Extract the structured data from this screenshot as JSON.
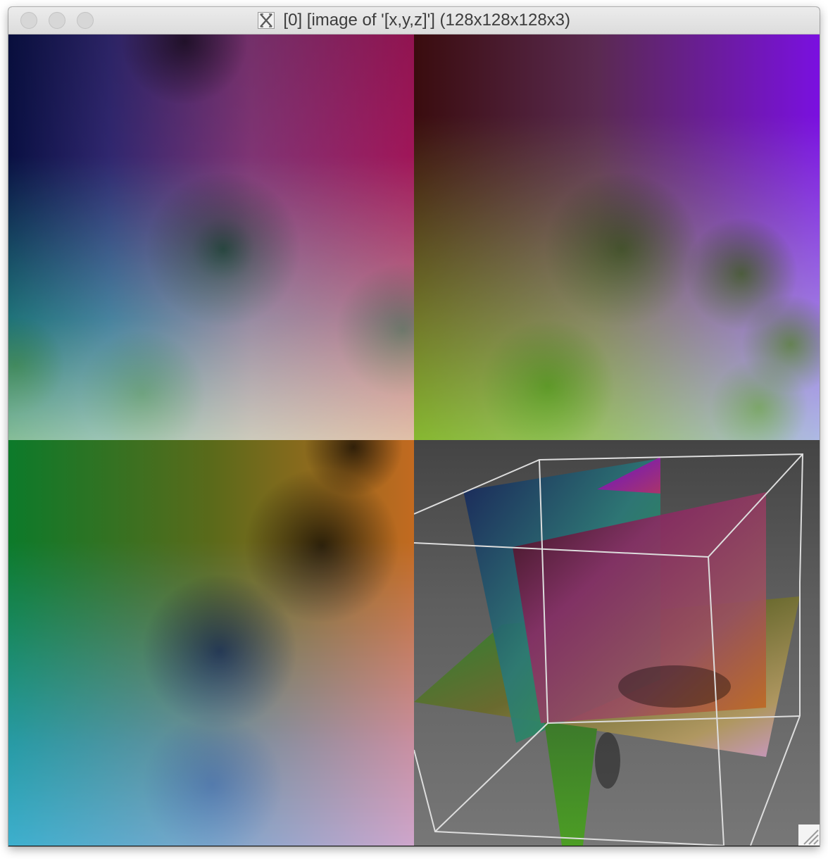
{
  "window": {
    "title": "[0] [image of '[x,y,z]'] (128x128x128x3)",
    "app_icon": "x11-icon"
  },
  "views": [
    {
      "name": "xy-slice"
    },
    {
      "name": "xz-slice"
    },
    {
      "name": "yz-slice"
    },
    {
      "name": "3d-view"
    }
  ],
  "colors": {
    "background_3d_top": "#444444",
    "background_3d_bottom": "#777777",
    "wireframe": "#dddddd"
  },
  "controls": {
    "resize_grip": "resize-grip-icon"
  }
}
